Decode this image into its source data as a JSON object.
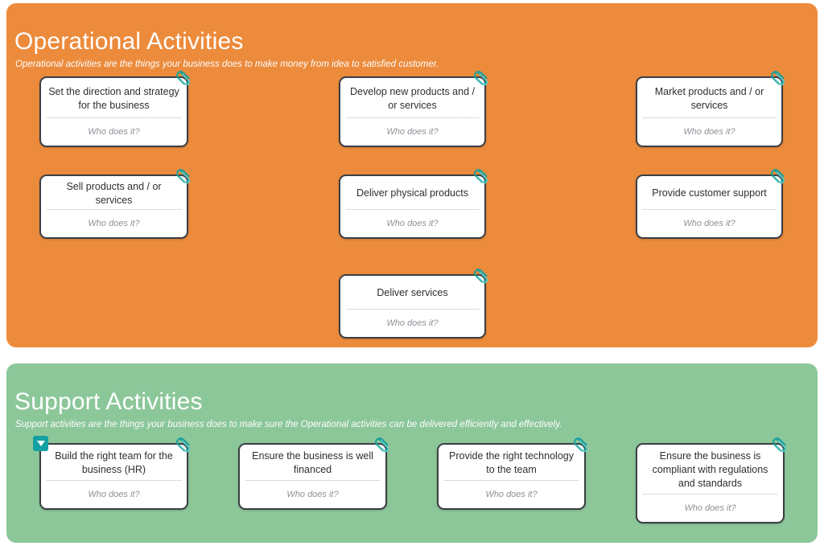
{
  "sections": [
    {
      "id": "operational",
      "title": "Operational Activities",
      "subtitle": "Operational activities are the things your business does to make money from idea to satisfied customer.",
      "color": "#ec8b3c",
      "cards": [
        {
          "title": "Set the direction and strategy for the business",
          "footer": "Who does it?",
          "icon": "paperclip-icon",
          "marker": false
        },
        {
          "title": "Develop new products and / or services",
          "footer": "Who does it?",
          "icon": "paperclip-icon",
          "marker": false
        },
        {
          "title": "Market products and / or services",
          "footer": "Who does it?",
          "icon": "paperclip-icon",
          "marker": false
        },
        {
          "title": "Sell products and / or services",
          "footer": "Who does it?",
          "icon": "paperclip-icon",
          "marker": false
        },
        {
          "title": "Deliver physical products",
          "footer": "Who does it?",
          "icon": "paperclip-icon",
          "marker": false
        },
        {
          "title": "Provide customer support",
          "footer": "Who does it?",
          "icon": "paperclip-icon",
          "marker": false
        },
        {
          "title": "Deliver services",
          "footer": "Who does it?",
          "icon": "paperclip-icon",
          "marker": false
        }
      ]
    },
    {
      "id": "support",
      "title": "Support Activities",
      "subtitle": "Support activities are the things your business does to make sure the Operational activities can be delivered efficiently and effectively.",
      "color": "#8cc79a",
      "cards": [
        {
          "title": "Build the right team for the business (HR)",
          "footer": "Who does it?",
          "icon": "paperclip-icon",
          "marker": true
        },
        {
          "title": "Ensure the business is well financed",
          "footer": "Who does it?",
          "icon": "paperclip-icon",
          "marker": false
        },
        {
          "title": "Provide the right technology to the team",
          "footer": "Who does it?",
          "icon": "paperclip-icon",
          "marker": false
        },
        {
          "title": "Ensure the business is compliant with regulations and standards",
          "footer": "Who does it?",
          "icon": "paperclip-icon",
          "marker": false
        }
      ]
    }
  ],
  "theme": {
    "orange": "#ec8b3c",
    "green": "#8cc79a",
    "card_border": "#3a3f45",
    "accent_teal": "#13a0a0",
    "page_background": "#ffffff"
  }
}
